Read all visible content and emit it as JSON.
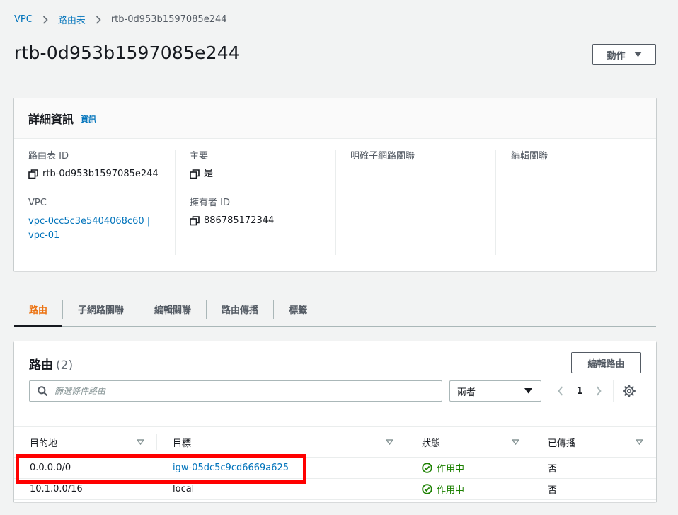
{
  "breadcrumb": {
    "items": [
      "VPC",
      "路由表"
    ],
    "current": "rtb-0d953b1597085e244"
  },
  "page": {
    "title": "rtb-0d953b1597085e244",
    "actions_label": "動作"
  },
  "details": {
    "header": "詳細資訊",
    "info_link": "資訊",
    "route_table_id_label": "路由表 ID",
    "route_table_id_value": "rtb-0d953b1597085e244",
    "vpc_label": "VPC",
    "vpc_value": "vpc-0cc5c3e5404068c60 |",
    "vpc_value_line2": "vpc-01",
    "main_label": "主要",
    "main_value": "是",
    "owner_label": "擁有者 ID",
    "owner_value": "886785172344",
    "explicit_subnet_label": "明確子網路關聯",
    "explicit_subnet_value": "–",
    "edge_assoc_label": "編輯關聯",
    "edge_assoc_value": "–"
  },
  "tabs": [
    "路由",
    "子網路關聯",
    "編輯關聯",
    "路由傳播",
    "標籤"
  ],
  "routes": {
    "title": "路由",
    "count": "(2)",
    "edit_button": "編輯路由",
    "search_placeholder": "篩選條件路由",
    "select_value": "兩者",
    "page_number": "1",
    "columns": [
      "目的地",
      "目標",
      "狀態",
      "已傳播"
    ],
    "rows": [
      {
        "destination": "0.0.0.0/0",
        "target": "igw-05dc5c9cd6669a625",
        "status": "作用中",
        "propagated": "否"
      },
      {
        "destination": "10.1.0.0/16",
        "target": "local",
        "status": "作用中",
        "propagated": "否"
      }
    ]
  },
  "colors": {
    "link": "#0073bb",
    "active_tab": "#ec7211",
    "status_ok": "#1d8102",
    "highlight": "#ff0000"
  },
  "icons": [
    "chevron-right-icon",
    "caret-down-icon",
    "copy-icon",
    "search-icon",
    "chevron-left-icon",
    "settings-gear-icon",
    "sort-icon",
    "status-success-icon"
  ]
}
